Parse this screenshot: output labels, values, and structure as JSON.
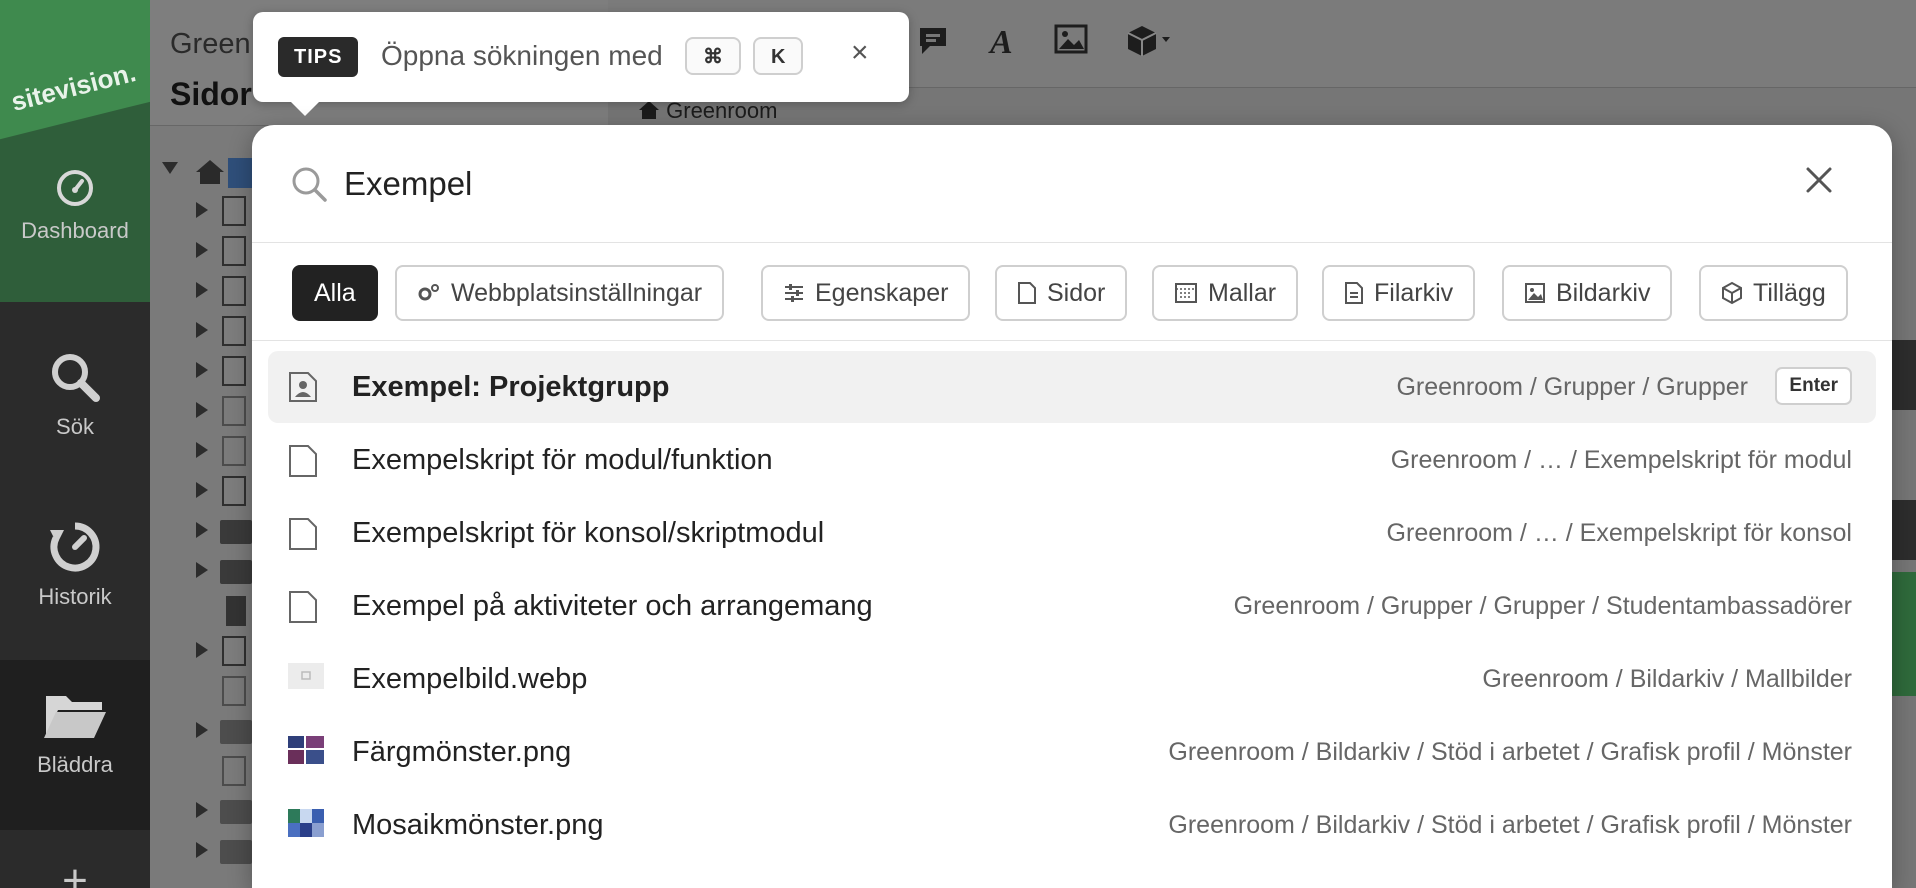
{
  "sidebar": {
    "logo": "sitevision.",
    "items": [
      {
        "label": "Dashboard",
        "icon": "gauge-icon"
      },
      {
        "label": "Sök",
        "icon": "search-icon"
      },
      {
        "label": "Historik",
        "icon": "history-icon"
      },
      {
        "label": "Bläddra",
        "icon": "folder-open-icon"
      }
    ]
  },
  "tree": {
    "title": "Green",
    "subtitle": "Sidor"
  },
  "main": {
    "breadcrumb": "Greenroom"
  },
  "tips": {
    "badge": "TIPS",
    "text": "Öppna sökningen med",
    "key1": "⌘",
    "key2": "K",
    "close": "×"
  },
  "search": {
    "value": "Exempel",
    "placeholder": ""
  },
  "filters": [
    {
      "label": "Alla",
      "active": true
    },
    {
      "label": "Webbplatsinställningar",
      "icon": "gears-icon"
    },
    {
      "label": "Egenskaper",
      "icon": "sliders-icon"
    },
    {
      "label": "Sidor",
      "icon": "page-icon"
    },
    {
      "label": "Mallar",
      "icon": "template-icon"
    },
    {
      "label": "Filarkiv",
      "icon": "file-text-icon"
    },
    {
      "label": "Bildarkiv",
      "icon": "image-icon"
    },
    {
      "label": "Tillägg",
      "icon": "cube-icon"
    }
  ],
  "results": [
    {
      "title": "Exempel: Projektgrupp",
      "path": "Greenroom / Grupper / Grupper",
      "icon": "group-portrait-icon",
      "selected": true,
      "hint": "Enter"
    },
    {
      "title": "Exempelskript för modul/funktion",
      "path": "Greenroom / … / Exempelskript för modul",
      "icon": "page-icon"
    },
    {
      "title": "Exempelskript för konsol/skriptmodul",
      "path": "Greenroom / … / Exempelskript för konsol",
      "icon": "page-icon"
    },
    {
      "title": "Exempel på aktiviteter och arrangemang",
      "path": "Greenroom / Grupper / Grupper / Studentambassadörer",
      "icon": "page-icon"
    },
    {
      "title": "Exempelbild.webp",
      "path": "Greenroom / Bildarkiv / Mallbilder",
      "icon": "image-thumbnail-icon"
    },
    {
      "title": "Färgmönster.png",
      "path": "Greenroom / Bildarkiv / Stöd i arbetet / Grafisk profil / Mönster",
      "icon": "color-pattern-thumbnail-icon"
    },
    {
      "title": "Mosaikmönster.png",
      "path": "Greenroom / Bildarkiv / Stöd i arbetet / Grafisk profil / Mönster",
      "icon": "mosaic-thumbnail-icon"
    }
  ],
  "colors": {
    "sidebar_bg": "#2b2b2b",
    "brand_green": "#3f8a4e",
    "chip_active": "#222222",
    "selected_row": "#f1f1f1"
  }
}
